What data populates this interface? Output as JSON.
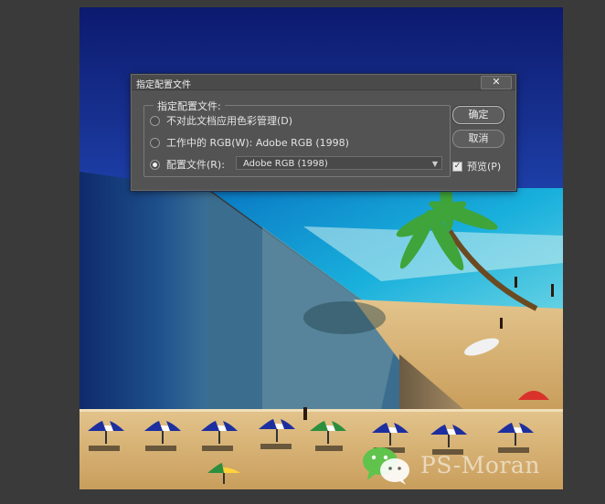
{
  "dialog": {
    "title": "指定配置文件",
    "close_glyph": "✕",
    "group_label": "指定配置文件:",
    "options": [
      {
        "label": "不对此文档应用色彩管理(D)",
        "selected": false
      },
      {
        "label": "工作中的 RGB(W): Adobe RGB (1998)",
        "selected": false
      },
      {
        "label": "配置文件(R):",
        "selected": true
      }
    ],
    "profile_select": {
      "value": "Adobe RGB (1998)",
      "arrow_icon": "chevron-down-icon"
    },
    "ok_label": "确定",
    "cancel_label": "取消",
    "preview": {
      "label": "预览(P)",
      "checked": true
    }
  },
  "watermark": {
    "text": "PS-Moran",
    "icon": "wechat-icon"
  },
  "colors": {
    "app_background": "#3a3a3a",
    "dialog_background": "#535353",
    "deep_sea": "#14247a",
    "turquoise_water": "#1fb3d8",
    "sand": "#d8b276"
  }
}
